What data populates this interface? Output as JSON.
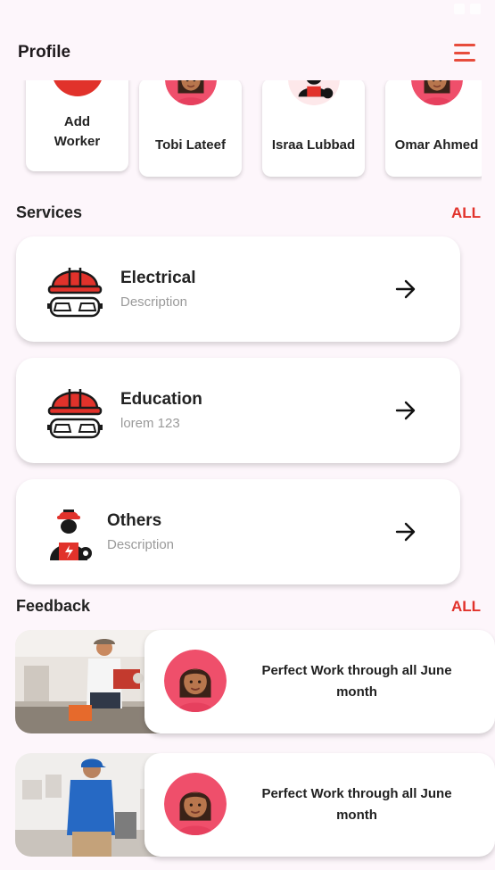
{
  "app_bar": {
    "title": "Profile",
    "menu_icon": "menu-icon"
  },
  "workers": {
    "add": {
      "label": "Add Worker",
      "icon": "plus-icon"
    },
    "items": [
      {
        "name": "Tobi Lateef",
        "avatar": "girl-avatar"
      },
      {
        "name": "Israa Lubbad",
        "avatar": "worker-avatar"
      },
      {
        "name": "Omar Ahmed",
        "avatar": "girl-avatar"
      }
    ]
  },
  "services": {
    "title": "Services",
    "all_label": "ALL",
    "items": [
      {
        "name": "Electrical",
        "description": "Description",
        "icon": "hardhat-goggles-icon"
      },
      {
        "name": "Education",
        "description": "lorem 123",
        "icon": "hardhat-goggles-icon"
      },
      {
        "name": "Others",
        "description": "Description",
        "icon": "electrician-icon"
      }
    ]
  },
  "feedback": {
    "title": "Feedback",
    "all_label": "ALL",
    "items": [
      {
        "text": "Perfect Work through all June month",
        "photo": "worker-photo",
        "avatar": "girl-avatar"
      },
      {
        "text": "Perfect Work through all June month",
        "photo": "worker-photo",
        "avatar": "girl-avatar"
      }
    ]
  },
  "colors": {
    "accent": "#e1322b",
    "background": "#fdf6fb",
    "card": "#ffffff"
  }
}
